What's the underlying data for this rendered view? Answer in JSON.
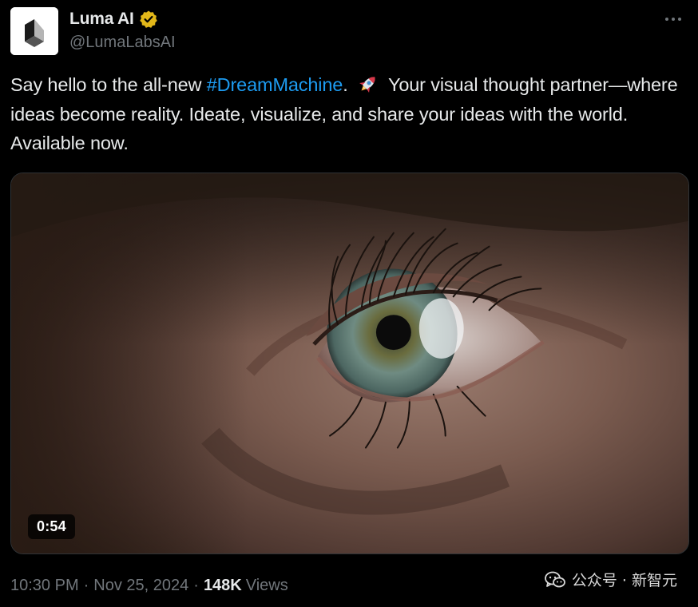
{
  "account": {
    "display_name": "Luma AI",
    "handle": "@LumaLabsAI",
    "verified": true,
    "verified_color": "#e2b719",
    "avatar_icon": "luma-cube-logo-icon"
  },
  "tweet": {
    "text_before": "Say hello to the all-new ",
    "hashtag": "#DreamMachine",
    "text_middle": ". ",
    "emoji_icon": "rocket-icon",
    "text_after": " Your visual thought partner—where ideas become reality. Ideate, visualize, and share your ideas with the world. Available now.",
    "hashtag_color": "#1d9bf0"
  },
  "media": {
    "type": "video",
    "duration": "0:54",
    "subject": "close-up eye"
  },
  "footer": {
    "time": "10:30 PM",
    "separator": "·",
    "date": "Nov 25, 2024",
    "views_count": "148K",
    "views_label": "Views"
  },
  "watermark": {
    "icon": "wechat-icon",
    "text": "公众号 · 新智元"
  },
  "colors": {
    "background": "#000000",
    "primary_text": "#e7e9ea",
    "secondary_text": "#71767b"
  }
}
